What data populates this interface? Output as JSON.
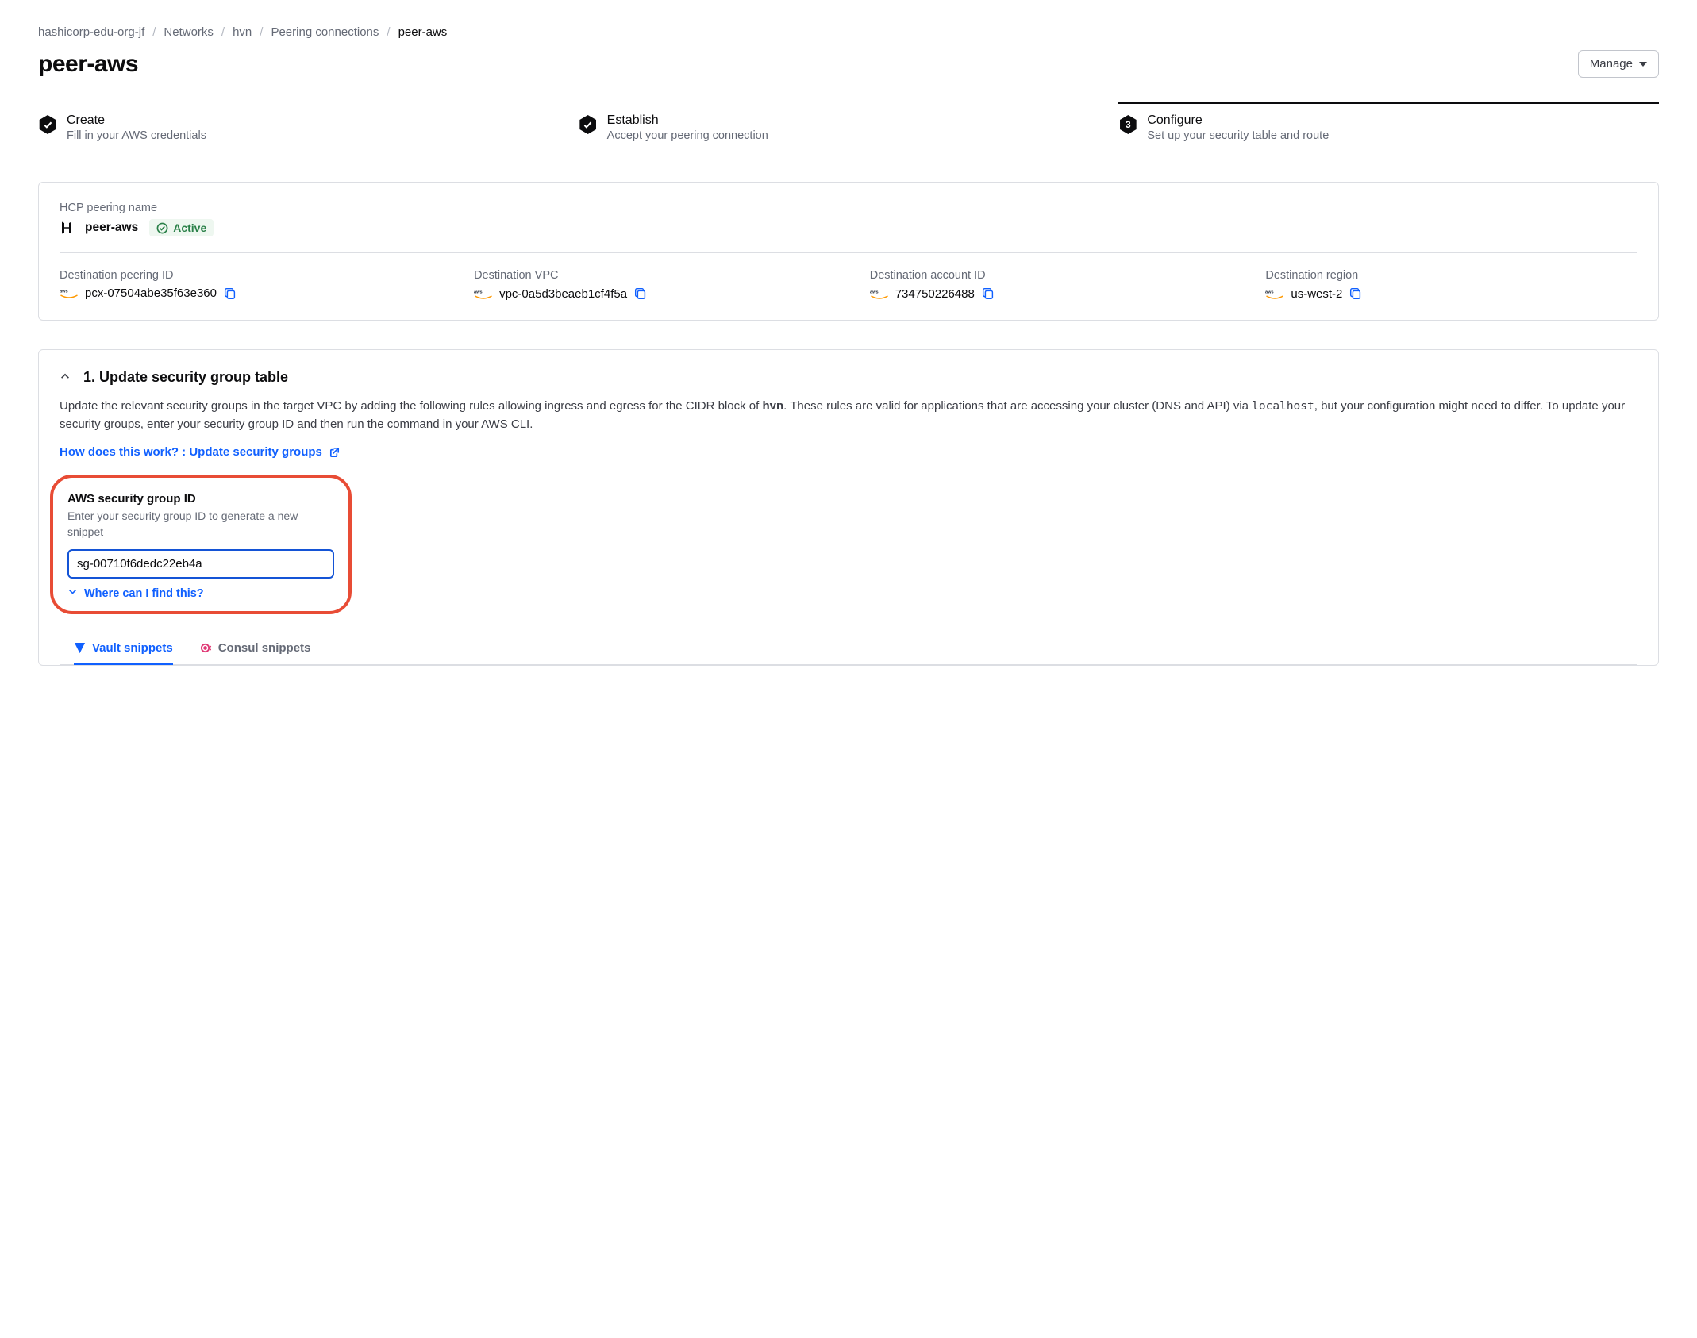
{
  "breadcrumb": {
    "items": [
      "hashicorp-edu-org-jf",
      "Networks",
      "hvn",
      "Peering connections"
    ],
    "current": "peer-aws"
  },
  "page": {
    "title": "peer-aws"
  },
  "buttons": {
    "manage": "Manage"
  },
  "steps": [
    {
      "title": "Create",
      "sub": "Fill in your AWS credentials",
      "done": true,
      "num": ""
    },
    {
      "title": "Establish",
      "sub": "Accept your peering connection",
      "done": true,
      "num": ""
    },
    {
      "title": "Configure",
      "sub": "Set up your security table and route",
      "done": false,
      "num": "3",
      "active": true
    }
  ],
  "card": {
    "label": "HCP peering name",
    "name": "peer-aws",
    "status": "Active",
    "dest": [
      {
        "label": "Destination peering ID",
        "value": "pcx-07504abe35f63e360",
        "wrap": true
      },
      {
        "label": "Destination VPC",
        "value": "vpc-0a5d3beaeb1cf4f5a"
      },
      {
        "label": "Destination account ID",
        "value": "734750226488"
      },
      {
        "label": "Destination region",
        "value": "us-west-2"
      }
    ]
  },
  "section": {
    "title": "1. Update security group table",
    "body_pre": "Update the relevant security groups in the target VPC by adding the following rules allowing ingress and egress for the CIDR block of ",
    "body_bold": "hvn",
    "body_mid": ". These rules are valid for applications that are accessing your cluster (DNS and API) via ",
    "body_code": "localhost",
    "body_post": ", but your configuration might need to differ. To update your security groups, enter your security group ID and then run the command in your AWS CLI.",
    "help_link": "How does this work? : Update security groups",
    "field_label": "AWS security group ID",
    "field_help": "Enter your security group ID to generate a new snippet",
    "field_value": "sg-00710f6dedc22eb4a",
    "find_link": "Where can I find this?"
  },
  "tabs": [
    {
      "label": "Vault snippets",
      "active": true,
      "color": "#1060ff"
    },
    {
      "label": "Consul snippets",
      "active": false,
      "color": "#e03875"
    }
  ]
}
